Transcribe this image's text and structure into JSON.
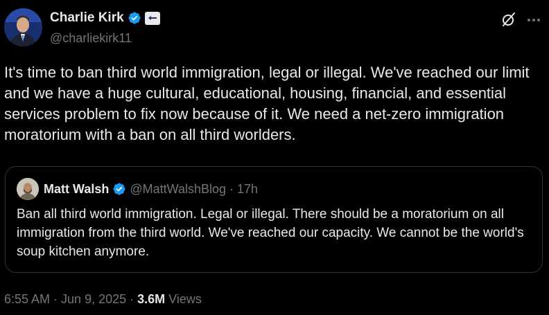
{
  "author": {
    "display_name": "Charlie Kirk",
    "handle": "@charliekirk11"
  },
  "tweet": {
    "text": "It's time to ban third world immigration, legal or illegal. We've reached our limit and we have a huge cultural, educational, housing, financial, and essential services problem to fix now because of it. We need a net-zero immigration moratorium with a ban on all third worlders."
  },
  "quoted": {
    "display_name": "Matt Walsh",
    "handle": "@MattWalshBlog",
    "separator": "·",
    "time": "17h",
    "text": "Ban all third world immigration. Legal or illegal. There should be a moratorium on all immigration from the third world. We've reached our capacity. We cannot be the world's soup kitchen anymore."
  },
  "meta": {
    "time": "6:55 AM",
    "separator1": "·",
    "date": "Jun 9, 2025",
    "separator2": "·",
    "views_count": "3.6M",
    "views_label": "Views"
  },
  "icons": {
    "verified": "verified-badge-icon",
    "grok": "grok-icon",
    "more": "more-icon"
  },
  "colors": {
    "background": "#000000",
    "text": "#e7e9ea",
    "secondary": "#71767b",
    "verified": "#1d9bf0",
    "border": "#2f3336"
  }
}
